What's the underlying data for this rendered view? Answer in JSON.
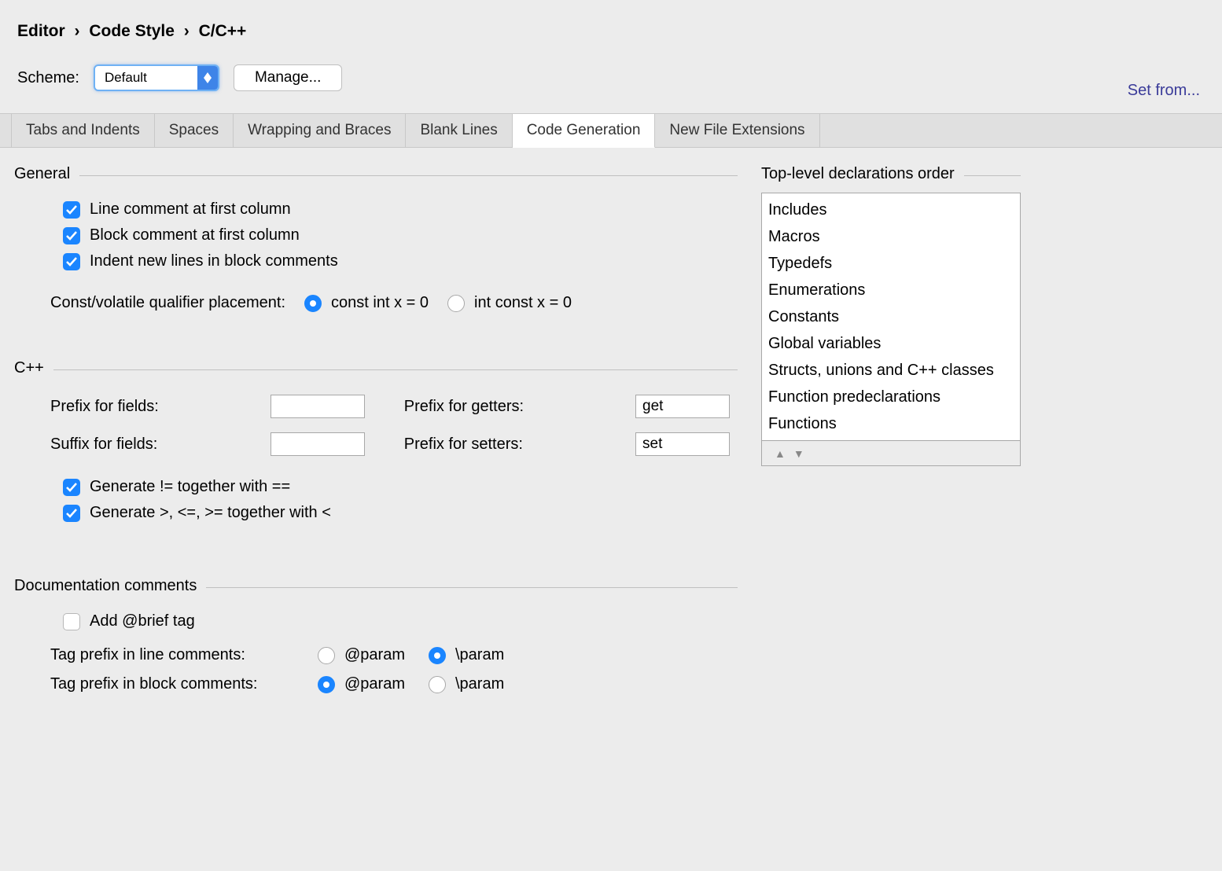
{
  "breadcrumb": {
    "p0": "Editor",
    "p1": "Code Style",
    "p2": "C/C++"
  },
  "scheme": {
    "label": "Scheme:",
    "value": "Default",
    "manage": "Manage..."
  },
  "setFrom": "Set from...",
  "tabs": {
    "t0": "Tabs and Indents",
    "t1": "Spaces",
    "t2": "Wrapping and Braces",
    "t3": "Blank Lines",
    "t4": "Code Generation",
    "t5": "New File Extensions"
  },
  "sections": {
    "general": "General",
    "cpp": "C++",
    "doc": "Documentation comments",
    "order": "Top-level declarations order"
  },
  "general": {
    "lineComment": "Line comment at first column",
    "blockComment": "Block comment at first column",
    "indentNew": "Indent new lines in block comments",
    "cvLabel": "Const/volatile qualifier placement:",
    "cvOpt1": "const int x = 0",
    "cvOpt2": "int const x = 0"
  },
  "cpp": {
    "prefixFields": "Prefix for fields:",
    "suffixFields": "Suffix for fields:",
    "prefixGetters": "Prefix for getters:",
    "prefixSetters": "Prefix for setters:",
    "prefixFieldsVal": "",
    "suffixFieldsVal": "",
    "prefixGettersVal": "get",
    "prefixSettersVal": "set",
    "genNe": "Generate != together with ==",
    "genCmp": "Generate >, <=, >= together with <"
  },
  "doc": {
    "addBrief": "Add @brief tag",
    "lineLabel": "Tag prefix in line comments:",
    "blockLabel": "Tag prefix in block comments:",
    "at": "@param",
    "bs": "\\param"
  },
  "order": {
    "i0": "Includes",
    "i1": "Macros",
    "i2": "Typedefs",
    "i3": "Enumerations",
    "i4": "Constants",
    "i5": "Global variables",
    "i6": "Structs, unions and C++ classes",
    "i7": "Function predeclarations",
    "i8": "Functions"
  }
}
